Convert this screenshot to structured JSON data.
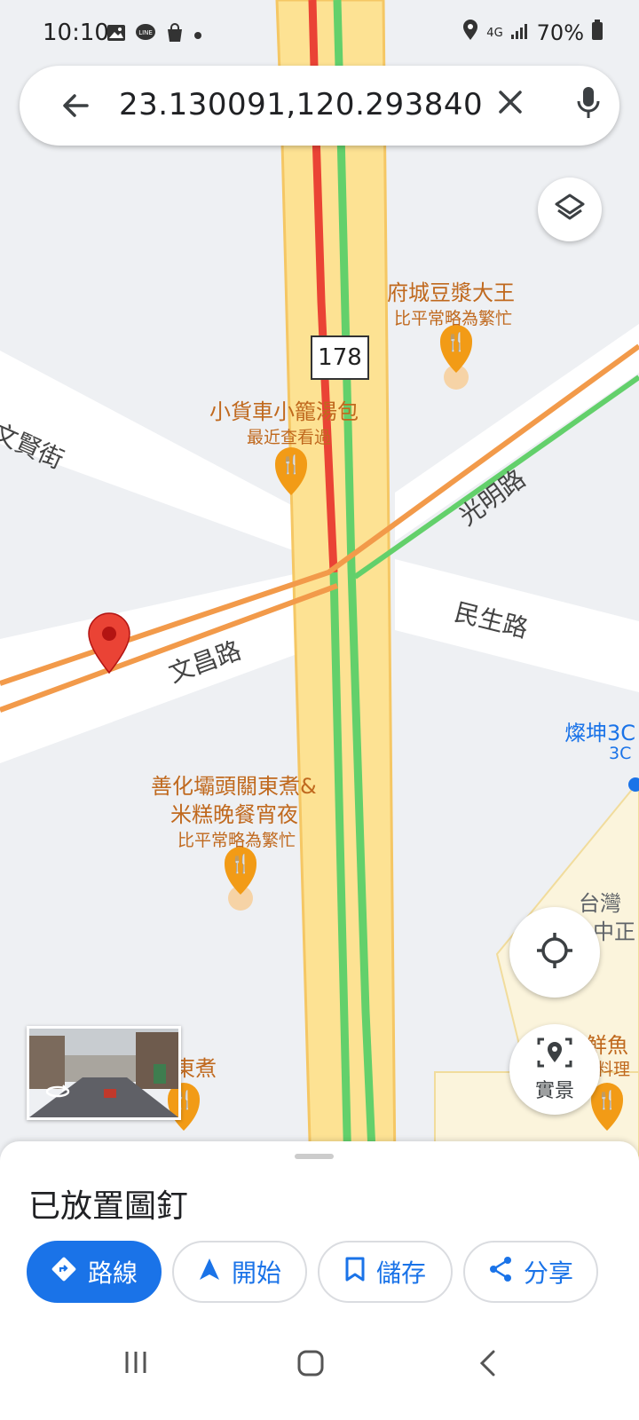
{
  "status_bar": {
    "time": "10:10",
    "network": "4G",
    "battery": "70%",
    "icons": [
      "gallery-icon",
      "line-icon",
      "shopping-bag-icon",
      "dot-icon",
      "location-icon",
      "signal-icon",
      "battery-icon"
    ]
  },
  "search": {
    "query": "23.130091,120.293840",
    "icons": [
      "back-arrow-icon",
      "close-icon",
      "mic-icon"
    ]
  },
  "map": {
    "route_shield": "178",
    "streets": [
      "文賢街",
      "光明路",
      "民生路",
      "文昌路"
    ],
    "pois": [
      {
        "title": "府城豆漿大王",
        "subtitle": "比平常略為繁忙"
      },
      {
        "title": "小貨車小籠湯包",
        "subtitle": "最近查看過"
      },
      {
        "title_line1": "善化壩頭關東煮&",
        "title_line2": "米糕晚餐宵夜",
        "subtitle": "比平常略為繁忙"
      }
    ],
    "partial_labels": [
      "燦坤3C",
      "3C",
      "台灣",
      "中正",
      "東煮",
      "鮮魚",
      "料理"
    ],
    "colors": {
      "road": "#fde293",
      "traffic_red": "#ea4335",
      "traffic_green": "#63d06b",
      "traffic_orange": "#f29a4a",
      "poi": "#f29b16",
      "pin": "#ea4335",
      "accent": "#1a73e8"
    }
  },
  "controls": {
    "layers_icon": "layers-icon",
    "my_location_icon": "crosshair-icon",
    "live_view_label": "實景"
  },
  "sheet": {
    "title": "已放置圖釘",
    "actions": [
      {
        "label": "路線",
        "icon": "directions-icon"
      },
      {
        "label": "開始",
        "icon": "navigation-icon"
      },
      {
        "label": "儲存",
        "icon": "bookmark-icon"
      },
      {
        "label": "分享",
        "icon": "share-icon"
      }
    ]
  }
}
